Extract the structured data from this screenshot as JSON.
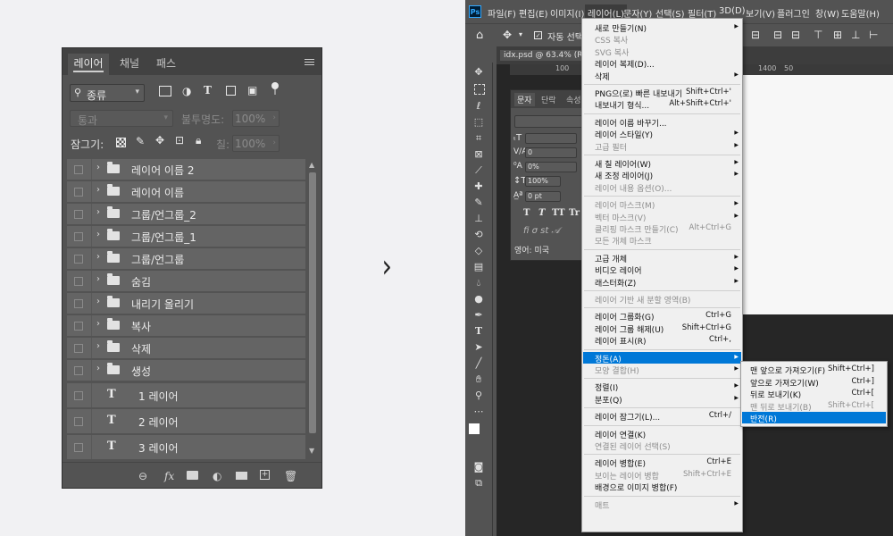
{
  "layers_panel": {
    "tabs": [
      "레이어",
      "채널",
      "패스"
    ],
    "filter_kind": "종류",
    "blend_mode": "통과",
    "opacity_label": "불투명도:",
    "opacity_value": "100%",
    "lock_label": "잠그기:",
    "fill_label": "칠:",
    "fill_value": "100%",
    "layers": [
      {
        "name": "레이어 이름 2",
        "type": "group"
      },
      {
        "name": "레이어 이름",
        "type": "group"
      },
      {
        "name": "그룹/언그룹_2",
        "type": "group"
      },
      {
        "name": "그룹/언그룹_1",
        "type": "group"
      },
      {
        "name": "그룹/언그룹",
        "type": "group"
      },
      {
        "name": "숨김",
        "type": "group"
      },
      {
        "name": "내리기 올리기",
        "type": "group"
      },
      {
        "name": "복사",
        "type": "group"
      },
      {
        "name": "삭제",
        "type": "group"
      },
      {
        "name": "생성",
        "type": "group"
      },
      {
        "name": "1 레이어",
        "type": "text"
      },
      {
        "name": "2 레이어",
        "type": "text"
      },
      {
        "name": "3 레이어",
        "type": "text"
      }
    ],
    "footer_icons": [
      "link-icon",
      "fx-icon",
      "mask-icon",
      "adjustment-icon",
      "folder-icon",
      "new-layer-icon",
      "trash-icon"
    ]
  },
  "arrow": "›",
  "photoshop": {
    "logo": "Ps",
    "menubar": [
      "파일(F)",
      "편집(E)",
      "이미지(I)",
      "레이어(L)",
      "문자(Y)",
      "선택(S)",
      "필터(T)",
      "3D(D)",
      "보기(V)",
      "플러그인",
      "창(W)",
      "도움말(H)"
    ],
    "active_menu": "레이어(L)",
    "options_bar": {
      "auto_select": "자동 선택"
    },
    "doc_tab": "idx.psd @ 63.4% (RGB/8#",
    "ruler_marks": [
      "100",
      "1400",
      "50"
    ],
    "char_panel": {
      "tabs": [
        "문자",
        "단락",
        "속성"
      ],
      "leading_value": "0",
      "tracking_value": "0%",
      "scale_value": "100%",
      "baseline_value": "0 pt",
      "type_buttons": [
        "T",
        "T",
        "TT",
        "Tr"
      ],
      "language": "영어: 미국"
    },
    "layer_menu": [
      {
        "label": "새로 만들기(N)",
        "submenu": true
      },
      {
        "label": "CSS 복사",
        "disabled": true
      },
      {
        "label": "SVG 복사",
        "disabled": true
      },
      {
        "label": "레이어 복제(D)..."
      },
      {
        "label": "삭제",
        "submenu": true
      },
      {
        "sep": true
      },
      {
        "label": "PNG으(로) 빠른 내보내기",
        "shortcut": "Shift+Ctrl+'"
      },
      {
        "label": "내보내기 형식...",
        "shortcut": "Alt+Shift+Ctrl+'"
      },
      {
        "sep": true
      },
      {
        "label": "레이어 이름 바꾸기..."
      },
      {
        "label": "레이어 스타일(Y)",
        "submenu": true
      },
      {
        "label": "고급 필터",
        "disabled": true,
        "submenu": true
      },
      {
        "sep": true
      },
      {
        "label": "새 칠 레이어(W)",
        "submenu": true
      },
      {
        "label": "새 조정 레이어(J)",
        "submenu": true
      },
      {
        "label": "레이어 내용 옵션(O)...",
        "disabled": true
      },
      {
        "sep": true
      },
      {
        "label": "레이어 마스크(M)",
        "disabled": true,
        "submenu": true
      },
      {
        "label": "벡터 마스크(V)",
        "disabled": true,
        "submenu": true
      },
      {
        "label": "클리핑 마스크 만들기(C)",
        "disabled": true,
        "shortcut": "Alt+Ctrl+G"
      },
      {
        "label": "모든 개체 마스크",
        "disabled": true
      },
      {
        "sep": true
      },
      {
        "label": "고급 개체",
        "submenu": true
      },
      {
        "label": "비디오 레이어",
        "submenu": true
      },
      {
        "label": "래스터화(Z)",
        "submenu": true
      },
      {
        "sep": true
      },
      {
        "label": "레이어 기반 새 분할 영역(B)",
        "disabled": true
      },
      {
        "sep": true
      },
      {
        "label": "레이어 그룹화(G)",
        "shortcut": "Ctrl+G"
      },
      {
        "label": "레이어 그룹 해제(U)",
        "shortcut": "Shift+Ctrl+G"
      },
      {
        "label": "레이어 표시(R)",
        "shortcut": "Ctrl+,"
      },
      {
        "sep": true
      },
      {
        "label": "정돈(A)",
        "submenu": true,
        "highlighted": true
      },
      {
        "label": "모양 결합(H)",
        "disabled": true,
        "submenu": true
      },
      {
        "sep": true
      },
      {
        "label": "정렬(I)",
        "submenu": true
      },
      {
        "label": "분포(Q)",
        "submenu": true
      },
      {
        "sep": true
      },
      {
        "label": "레이어 잠그기(L)...",
        "shortcut": "Ctrl+/"
      },
      {
        "sep": true
      },
      {
        "label": "레이어 연결(K)"
      },
      {
        "label": "연결된 레이어 선택(S)",
        "disabled": true
      },
      {
        "sep": true
      },
      {
        "label": "레이어 병합(E)",
        "shortcut": "Ctrl+E"
      },
      {
        "label": "보이는 레이어 병합",
        "disabled": true,
        "shortcut": "Shift+Ctrl+E"
      },
      {
        "label": "배경으로 이미지 병합(F)"
      },
      {
        "sep": true
      },
      {
        "label": "매트",
        "disabled": true,
        "submenu": true
      }
    ],
    "arrange_menu": [
      {
        "label": "맨 앞으로 가져오기(F)",
        "shortcut": "Shift+Ctrl+]"
      },
      {
        "label": "앞으로 가져오기(W)",
        "shortcut": "Ctrl+]"
      },
      {
        "label": "뒤로 보내기(K)",
        "shortcut": "Ctrl+["
      },
      {
        "label": "맨 뒤로 보내기(B)",
        "shortcut": "Shift+Ctrl+[",
        "disabled": true
      },
      {
        "label": "반전(R)",
        "highlighted": true
      }
    ]
  }
}
